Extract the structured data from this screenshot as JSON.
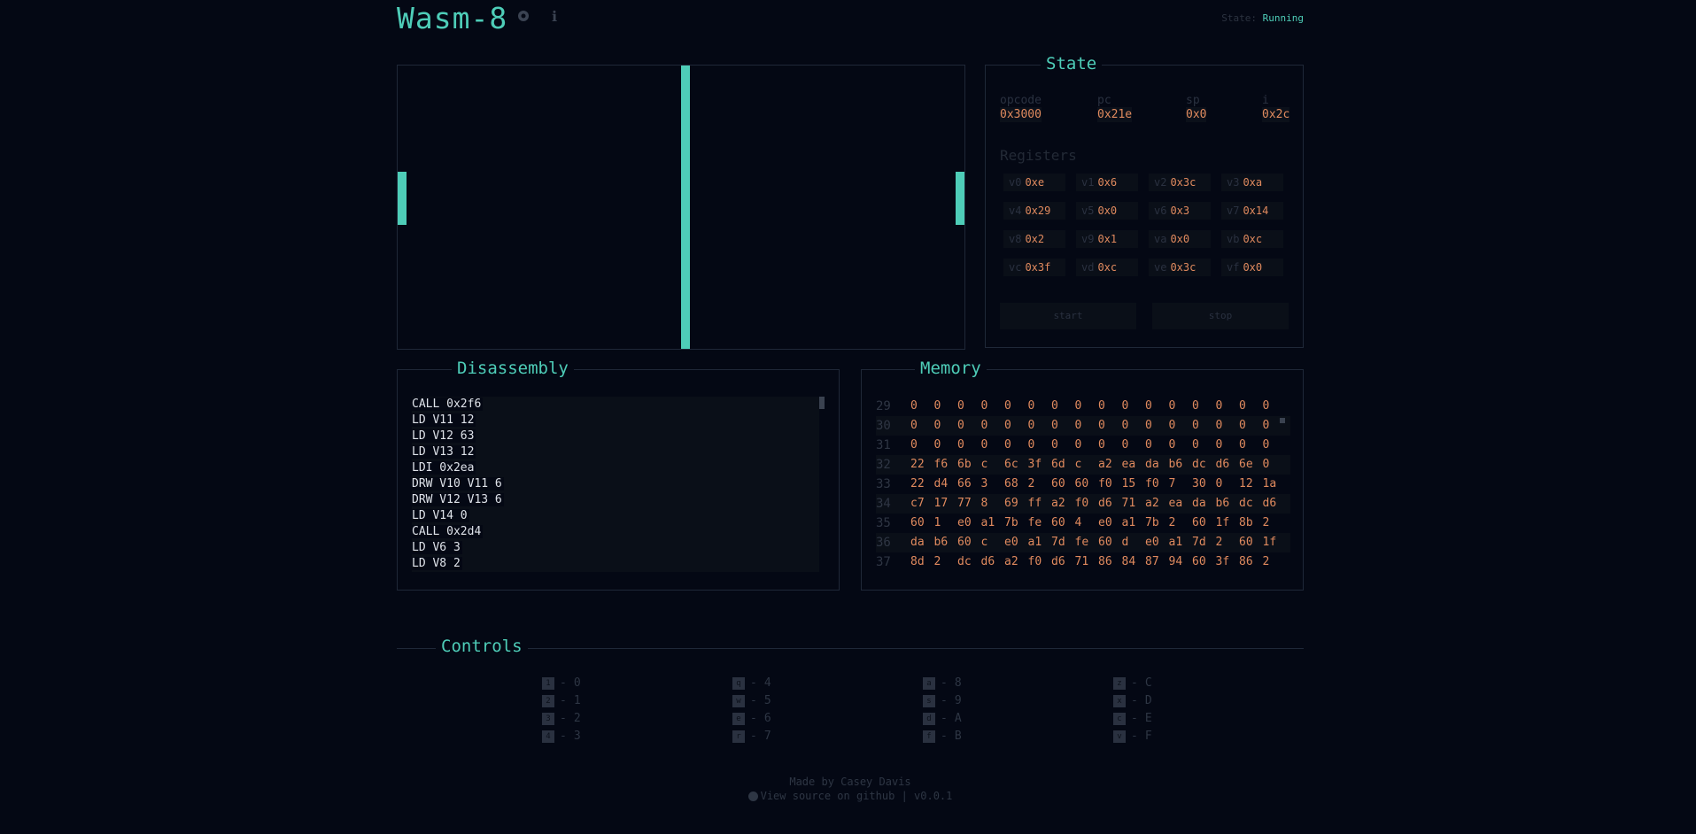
{
  "app": {
    "title": "Wasm-8",
    "status_label": "State:",
    "status_value": "Running"
  },
  "icons": {
    "settings": "gear-icon",
    "info": "info-icon"
  },
  "screen_pixels": [
    {
      "name": "left-paddle"
    },
    {
      "name": "center-net"
    },
    {
      "name": "right-paddle"
    }
  ],
  "state_panel": {
    "title": "State",
    "opcode": {
      "label": "opcode",
      "value": "0x3000"
    },
    "pc": {
      "label": "pc",
      "value": "0x21e"
    },
    "sp": {
      "label": "sp",
      "value": "0x0"
    },
    "i": {
      "label": "i",
      "value": "0x2c"
    },
    "registers_title": "Registers",
    "registers": [
      {
        "name": "v0",
        "value": "0xe"
      },
      {
        "name": "v1",
        "value": "0x6"
      },
      {
        "name": "v2",
        "value": "0x3c"
      },
      {
        "name": "v3",
        "value": "0xa"
      },
      {
        "name": "v4",
        "value": "0x29"
      },
      {
        "name": "v5",
        "value": "0x0"
      },
      {
        "name": "v6",
        "value": "0x3"
      },
      {
        "name": "v7",
        "value": "0x14"
      },
      {
        "name": "v8",
        "value": "0x2"
      },
      {
        "name": "v9",
        "value": "0x1"
      },
      {
        "name": "va",
        "value": "0x0"
      },
      {
        "name": "vb",
        "value": "0xc"
      },
      {
        "name": "vc",
        "value": "0x3f"
      },
      {
        "name": "vd",
        "value": "0xc"
      },
      {
        "name": "ve",
        "value": "0x3c"
      },
      {
        "name": "vf",
        "value": "0x0"
      }
    ],
    "start_label": "start",
    "stop_label": "stop"
  },
  "disassembly": {
    "title": "Disassembly",
    "lines": [
      "CALL 0x2f6",
      "LD V11 12",
      "LD V12 63",
      "LD V13 12",
      "LDI 0x2ea",
      "DRW V10 V11 6",
      "DRW V12 V13 6",
      "LD V14 0",
      "CALL 0x2d4",
      "LD V6 3",
      "LD V8 2"
    ]
  },
  "memory": {
    "title": "Memory",
    "rows": [
      {
        "num": "29",
        "cells": [
          "0",
          "0",
          "0",
          "0",
          "0",
          "0",
          "0",
          "0",
          "0",
          "0",
          "0",
          "0",
          "0",
          "0",
          "0",
          "0"
        ]
      },
      {
        "num": "30",
        "cells": [
          "0",
          "0",
          "0",
          "0",
          "0",
          "0",
          "0",
          "0",
          "0",
          "0",
          "0",
          "0",
          "0",
          "0",
          "0",
          "0"
        ]
      },
      {
        "num": "31",
        "cells": [
          "0",
          "0",
          "0",
          "0",
          "0",
          "0",
          "0",
          "0",
          "0",
          "0",
          "0",
          "0",
          "0",
          "0",
          "0",
          "0"
        ]
      },
      {
        "num": "32",
        "cells": [
          "22",
          "f6",
          "6b",
          "c",
          "6c",
          "3f",
          "6d",
          "c",
          "a2",
          "ea",
          "da",
          "b6",
          "dc",
          "d6",
          "6e",
          "0"
        ]
      },
      {
        "num": "33",
        "cells": [
          "22",
          "d4",
          "66",
          "3",
          "68",
          "2",
          "60",
          "60",
          "f0",
          "15",
          "f0",
          "7",
          "30",
          "0",
          "12",
          "1a"
        ]
      },
      {
        "num": "34",
        "cells": [
          "c7",
          "17",
          "77",
          "8",
          "69",
          "ff",
          "a2",
          "f0",
          "d6",
          "71",
          "a2",
          "ea",
          "da",
          "b6",
          "dc",
          "d6"
        ]
      },
      {
        "num": "35",
        "cells": [
          "60",
          "1",
          "e0",
          "a1",
          "7b",
          "fe",
          "60",
          "4",
          "e0",
          "a1",
          "7b",
          "2",
          "60",
          "1f",
          "8b",
          "2"
        ]
      },
      {
        "num": "36",
        "cells": [
          "da",
          "b6",
          "60",
          "c",
          "e0",
          "a1",
          "7d",
          "fe",
          "60",
          "d",
          "e0",
          "a1",
          "7d",
          "2",
          "60",
          "1f"
        ]
      },
      {
        "num": "37",
        "cells": [
          "8d",
          "2",
          "dc",
          "d6",
          "a2",
          "f0",
          "d6",
          "71",
          "86",
          "84",
          "87",
          "94",
          "60",
          "3f",
          "86",
          "2"
        ]
      }
    ]
  },
  "controls": {
    "title": "Controls",
    "mappings": [
      {
        "key": "1",
        "value": "0"
      },
      {
        "key": "2",
        "value": "1"
      },
      {
        "key": "3",
        "value": "2"
      },
      {
        "key": "4",
        "value": "3"
      },
      {
        "key": "q",
        "value": "4"
      },
      {
        "key": "w",
        "value": "5"
      },
      {
        "key": "e",
        "value": "6"
      },
      {
        "key": "r",
        "value": "7"
      },
      {
        "key": "a",
        "value": "8"
      },
      {
        "key": "s",
        "value": "9"
      },
      {
        "key": "d",
        "value": "A"
      },
      {
        "key": "f",
        "value": "B"
      },
      {
        "key": "z",
        "value": "C"
      },
      {
        "key": "x",
        "value": "D"
      },
      {
        "key": "c",
        "value": "E"
      },
      {
        "key": "v",
        "value": "F"
      }
    ],
    "separator": "-"
  },
  "footer": {
    "made_by": "Made by Casey Davis",
    "source_link": "View source on github",
    "divider": "|",
    "version": "v0.0.1"
  }
}
